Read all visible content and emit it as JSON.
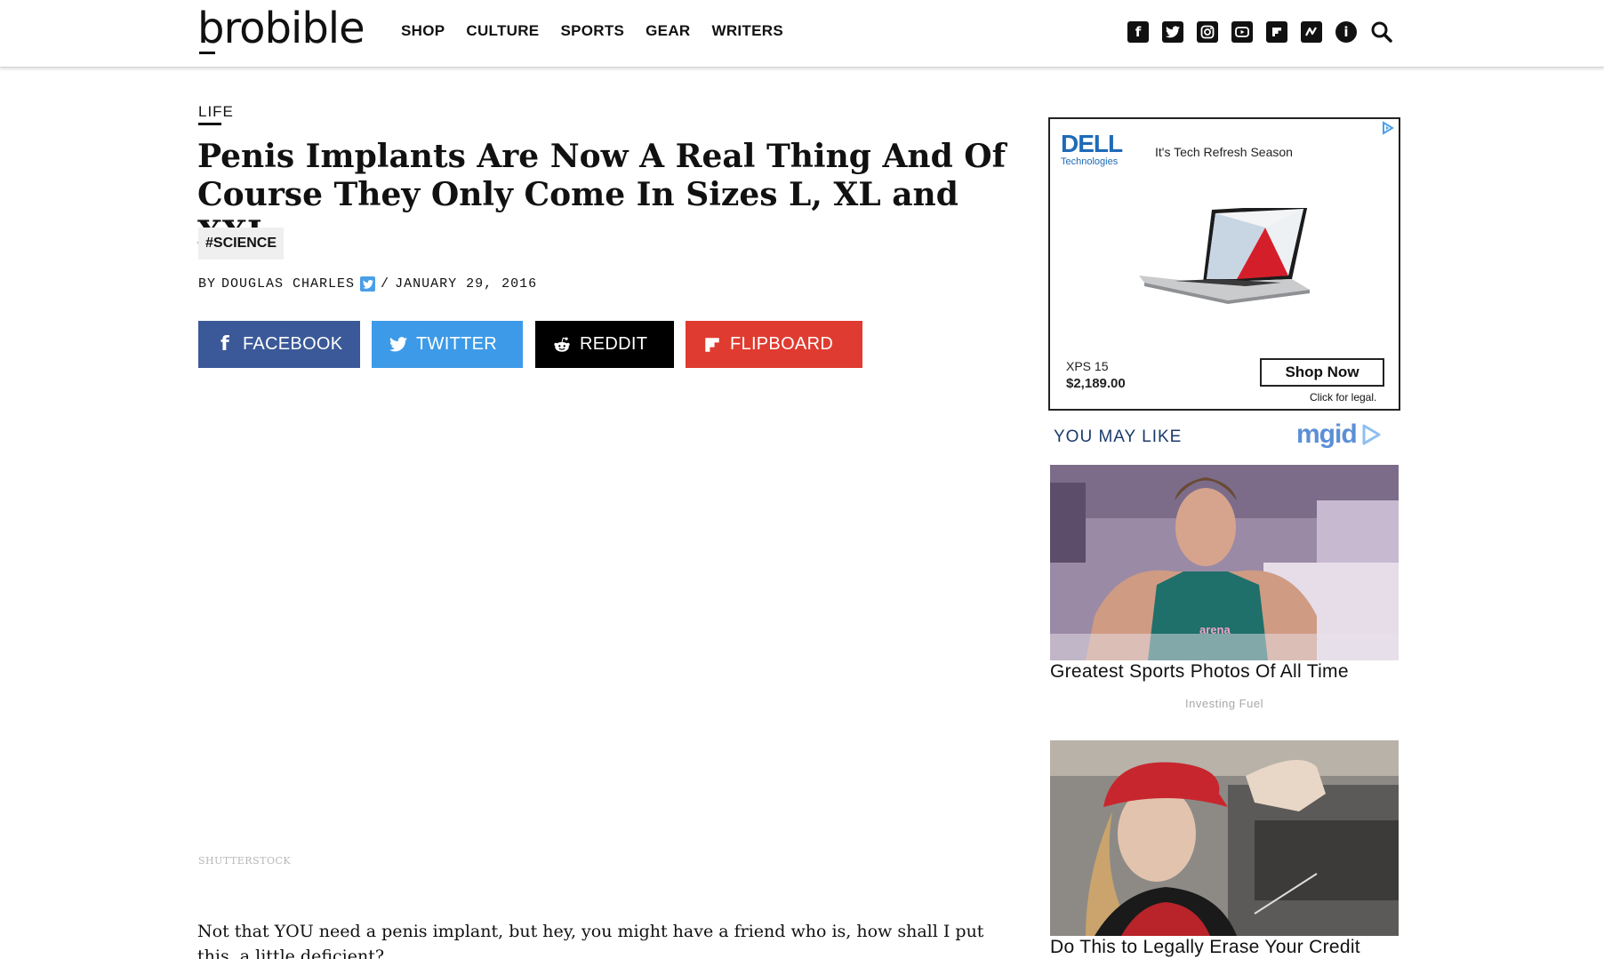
{
  "header": {
    "logo": "brobible",
    "nav": [
      "SHOP",
      "CULTURE",
      "SPORTS",
      "GEAR",
      "WRITERS"
    ],
    "social_icons": [
      "facebook-icon",
      "twitter-icon",
      "instagram-icon",
      "youtube-icon",
      "flipboard-icon",
      "newsbreak-icon",
      "info-icon",
      "search-icon"
    ]
  },
  "article": {
    "category": "LIFE",
    "headline": "Penis Implants Are Now A Real Thing And Of Course They Only Come In Sizes L, XL and XXL",
    "tag": "#SCIENCE",
    "byline_prefix": "BY",
    "author": "DOUGLAS CHARLES",
    "separator": "/",
    "date": "JANUARY 29, 2016",
    "share": {
      "facebook": "FACEBOOK",
      "twitter": "TWITTER",
      "reddit": "REDDIT",
      "flipboard": "FLIPBOARD"
    },
    "image_credit": "SHUTTERSTOCK",
    "body": "Not that YOU need a penis implant, but hey, you might have a friend who is, how shall I put this, a little deficient?"
  },
  "ad": {
    "brand": "DELL",
    "brand_sub": "Technologies",
    "tagline": "It's Tech Refresh Season",
    "product": "XPS 15",
    "price": "$2,189.00",
    "cta": "Shop Now",
    "legal": "Click for legal."
  },
  "widget": {
    "heading": "YOU MAY LIKE",
    "provider": "mgid",
    "cards": [
      {
        "title": "Greatest Sports Photos Of All Time",
        "source": "Investing Fuel"
      },
      {
        "title": "Do This to Legally Erase Your Credit"
      }
    ]
  },
  "colors": {
    "facebook": "#3b5998",
    "twitter": "#3d9ae8",
    "reddit": "#000000",
    "flipboard": "#e03b30"
  }
}
